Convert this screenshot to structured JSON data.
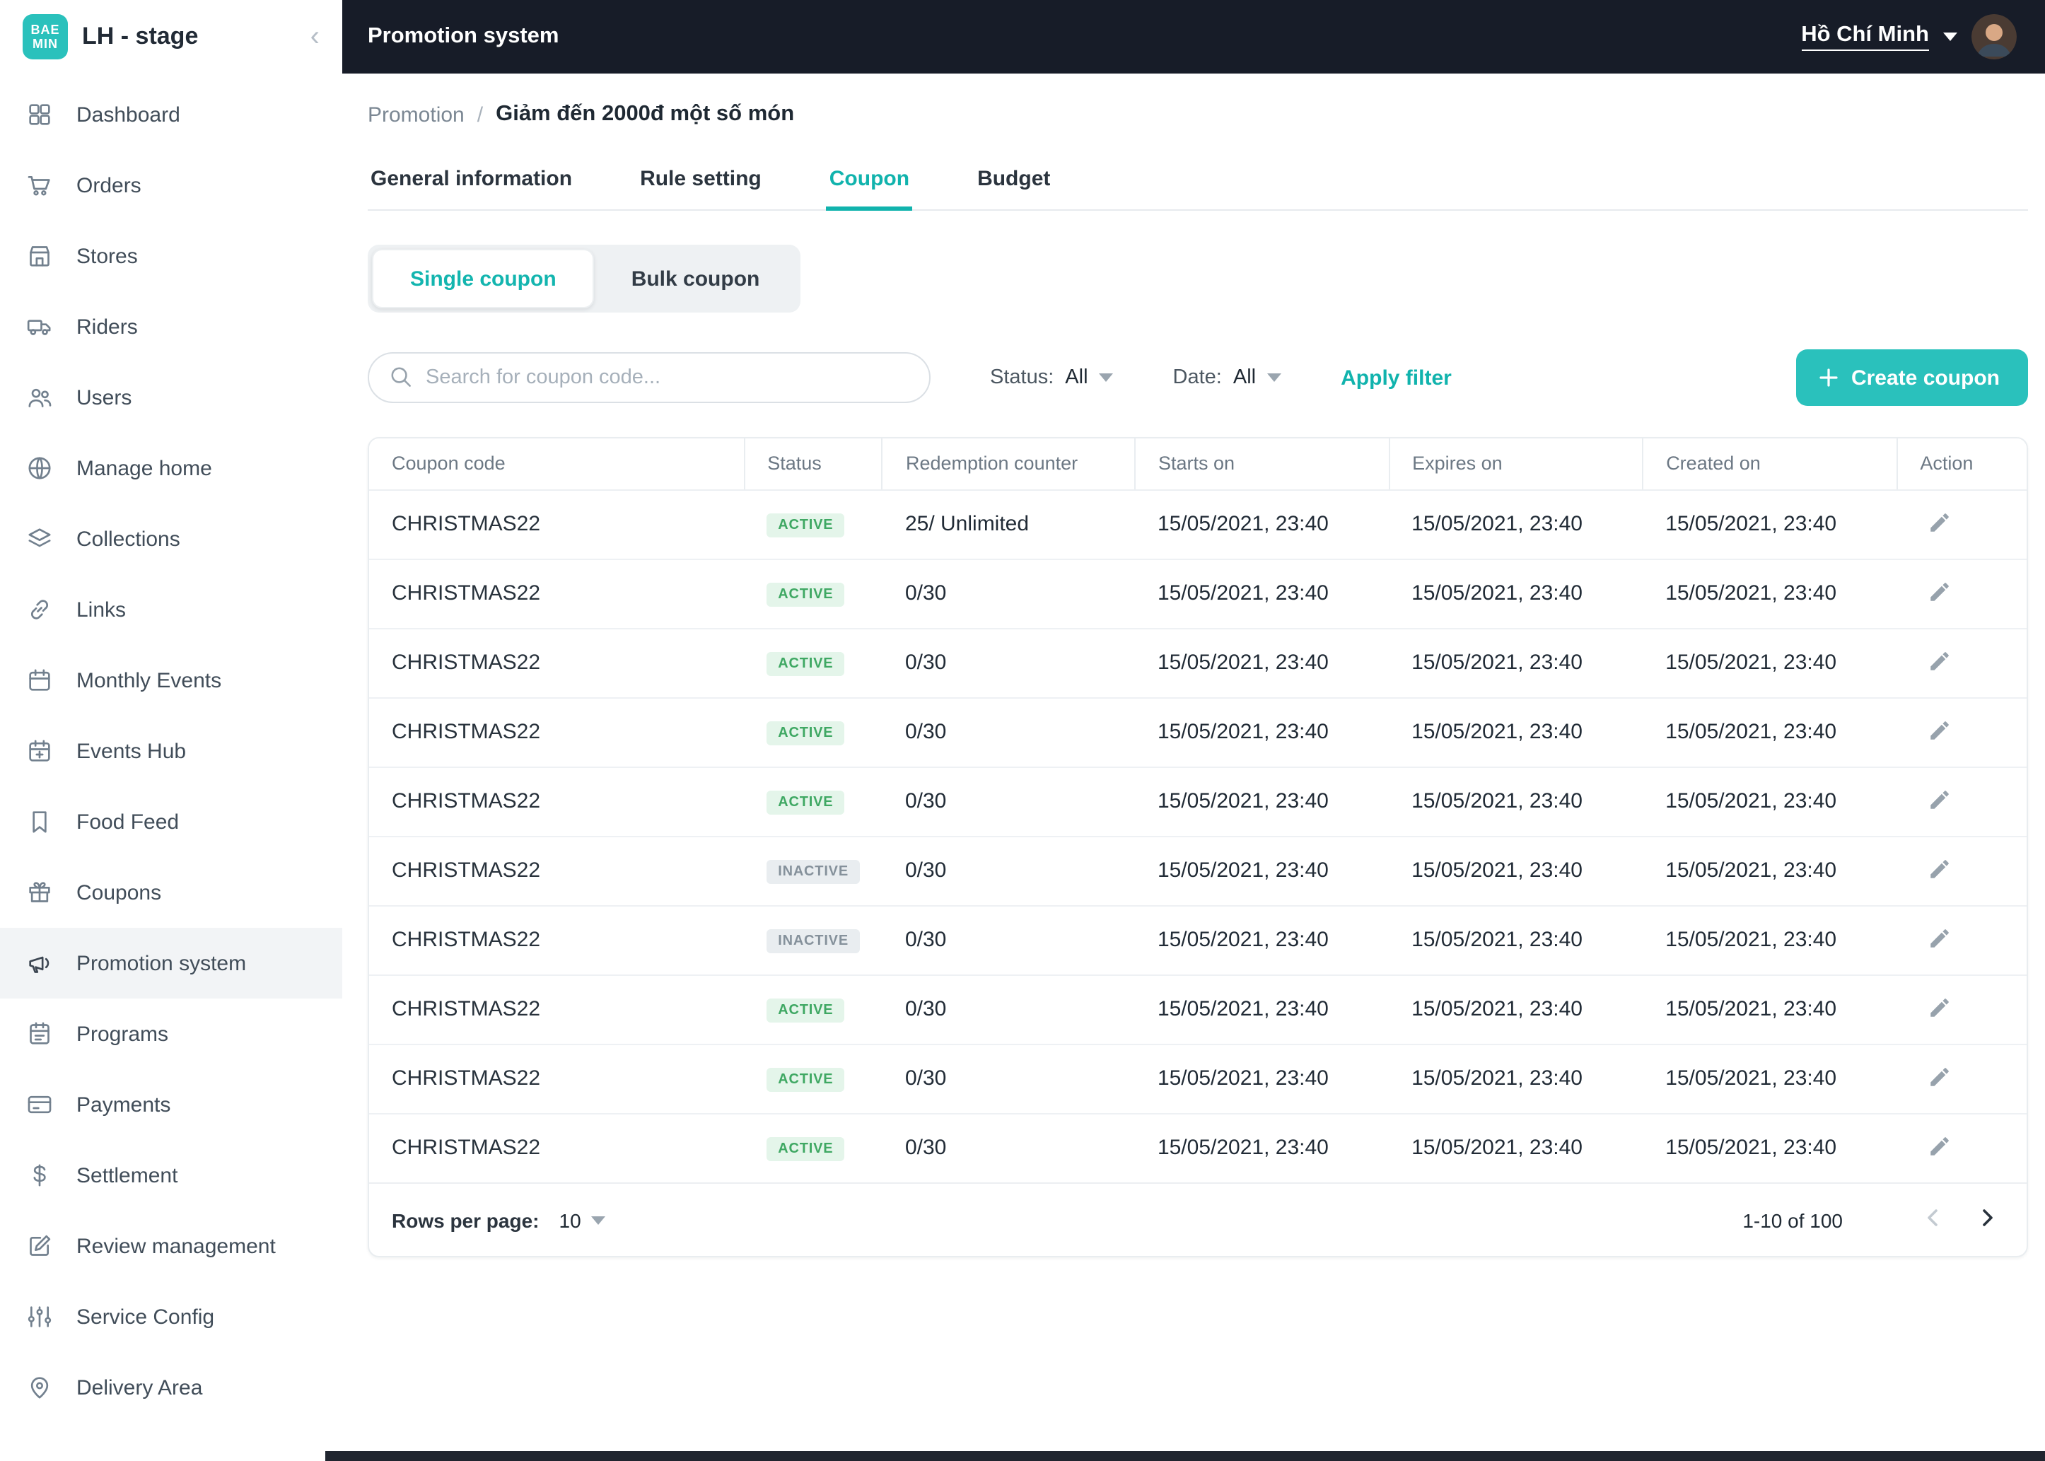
{
  "colors": {
    "accent": "#2ac1bc",
    "topbar_bg": "#171c28",
    "active_badge_bg": "#e4f5ea",
    "active_badge_text": "#3fa863",
    "inactive_badge_bg": "#e9edf0",
    "inactive_badge_text": "#85919b"
  },
  "sidebar": {
    "logo_line1": "BAE",
    "logo_line2": "MIN",
    "workspace": "LH - stage",
    "collapse_glyph": "‹",
    "items": [
      {
        "label": "Dashboard",
        "icon": "dashboard-icon",
        "active": false
      },
      {
        "label": "Orders",
        "icon": "orders-icon",
        "active": false
      },
      {
        "label": "Stores",
        "icon": "stores-icon",
        "active": false
      },
      {
        "label": "Riders",
        "icon": "riders-icon",
        "active": false
      },
      {
        "label": "Users",
        "icon": "users-icon",
        "active": false
      },
      {
        "label": "Manage home",
        "icon": "manage-home-icon",
        "active": false
      },
      {
        "label": "Collections",
        "icon": "collections-icon",
        "active": false
      },
      {
        "label": "Links",
        "icon": "links-icon",
        "active": false
      },
      {
        "label": "Monthly Events",
        "icon": "monthly-events-icon",
        "active": false
      },
      {
        "label": "Events Hub",
        "icon": "events-hub-icon",
        "active": false
      },
      {
        "label": "Food Feed",
        "icon": "food-feed-icon",
        "active": false
      },
      {
        "label": "Coupons",
        "icon": "coupons-icon",
        "active": false
      },
      {
        "label": "Promotion system",
        "icon": "promotion-system-icon",
        "active": true
      },
      {
        "label": "Programs",
        "icon": "programs-icon",
        "active": false
      },
      {
        "label": "Payments",
        "icon": "payments-icon",
        "active": false
      },
      {
        "label": "Settlement",
        "icon": "settlement-icon",
        "active": false
      },
      {
        "label": "Review management",
        "icon": "review-management-icon",
        "active": false
      },
      {
        "label": "Service Config",
        "icon": "service-config-icon",
        "active": false
      },
      {
        "label": "Delivery Area",
        "icon": "delivery-area-icon",
        "active": false
      }
    ]
  },
  "topbar": {
    "title": "Promotion system",
    "city": "Hồ Chí Minh"
  },
  "breadcrumb": {
    "parent": "Promotion",
    "separator": "/",
    "current": "Giảm đến 2000đ một số món"
  },
  "tabs": [
    {
      "label": "General information",
      "active": false
    },
    {
      "label": "Rule setting",
      "active": false
    },
    {
      "label": "Coupon",
      "active": true
    },
    {
      "label": "Budget",
      "active": false
    }
  ],
  "coupon_toggle": [
    {
      "label": "Single coupon",
      "active": true
    },
    {
      "label": "Bulk coupon",
      "active": false
    }
  ],
  "filters": {
    "search_placeholder": "Search for coupon code...",
    "status_label": "Status:",
    "status_value": "All",
    "date_label": "Date:",
    "date_value": "All",
    "apply_label": "Apply filter",
    "create_label": "Create coupon"
  },
  "table": {
    "columns": [
      "Coupon code",
      "Status",
      "Redemption counter",
      "Starts on",
      "Expires on",
      "Created on",
      "Action"
    ],
    "rows": [
      {
        "code": "CHRISTMAS22",
        "status": "ACTIVE",
        "redemption": "25/ Unlimited",
        "starts_on": "15/05/2021, 23:40",
        "expires_on": "15/05/2021, 23:40",
        "created_on": "15/05/2021, 23:40"
      },
      {
        "code": "CHRISTMAS22",
        "status": "ACTIVE",
        "redemption": "0/30",
        "starts_on": "15/05/2021, 23:40",
        "expires_on": "15/05/2021, 23:40",
        "created_on": "15/05/2021, 23:40"
      },
      {
        "code": "CHRISTMAS22",
        "status": "ACTIVE",
        "redemption": "0/30",
        "starts_on": "15/05/2021, 23:40",
        "expires_on": "15/05/2021, 23:40",
        "created_on": "15/05/2021, 23:40"
      },
      {
        "code": "CHRISTMAS22",
        "status": "ACTIVE",
        "redemption": "0/30",
        "starts_on": "15/05/2021, 23:40",
        "expires_on": "15/05/2021, 23:40",
        "created_on": "15/05/2021, 23:40"
      },
      {
        "code": "CHRISTMAS22",
        "status": "ACTIVE",
        "redemption": "0/30",
        "starts_on": "15/05/2021, 23:40",
        "expires_on": "15/05/2021, 23:40",
        "created_on": "15/05/2021, 23:40"
      },
      {
        "code": "CHRISTMAS22",
        "status": "INACTIVE",
        "redemption": "0/30",
        "starts_on": "15/05/2021, 23:40",
        "expires_on": "15/05/2021, 23:40",
        "created_on": "15/05/2021, 23:40"
      },
      {
        "code": "CHRISTMAS22",
        "status": "INACTIVE",
        "redemption": "0/30",
        "starts_on": "15/05/2021, 23:40",
        "expires_on": "15/05/2021, 23:40",
        "created_on": "15/05/2021, 23:40"
      },
      {
        "code": "CHRISTMAS22",
        "status": "ACTIVE",
        "redemption": "0/30",
        "starts_on": "15/05/2021, 23:40",
        "expires_on": "15/05/2021, 23:40",
        "created_on": "15/05/2021, 23:40"
      },
      {
        "code": "CHRISTMAS22",
        "status": "ACTIVE",
        "redemption": "0/30",
        "starts_on": "15/05/2021, 23:40",
        "expires_on": "15/05/2021, 23:40",
        "created_on": "15/05/2021, 23:40"
      },
      {
        "code": "CHRISTMAS22",
        "status": "ACTIVE",
        "redemption": "0/30",
        "starts_on": "15/05/2021, 23:40",
        "expires_on": "15/05/2021, 23:40",
        "created_on": "15/05/2021, 23:40"
      }
    ]
  },
  "pagination": {
    "rows_per_page_label": "Rows per page:",
    "rows_per_page_value": "10",
    "range": "1-10 of 100"
  }
}
